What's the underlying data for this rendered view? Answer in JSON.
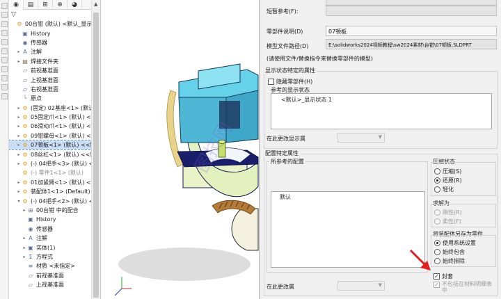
{
  "tree": {
    "tabs": [
      "◉",
      "▤",
      "⊞",
      "⊕",
      "◕"
    ],
    "filter_icon": "filter-icon",
    "items": [
      {
        "label": "00台钳 (默认) <默认_显示状",
        "arrow": "",
        "icon": "assembly-icon",
        "glyph": "⚙",
        "indent": 0,
        "cls": "ic-part",
        "state": ""
      },
      {
        "label": "History",
        "arrow": "",
        "icon": "history-icon",
        "glyph": "▣",
        "indent": 1,
        "cls": "ic-doc",
        "state": ""
      },
      {
        "label": "传感器",
        "arrow": "",
        "icon": "sensor-icon",
        "glyph": "◉",
        "indent": 1,
        "cls": "ic-doc",
        "state": ""
      },
      {
        "label": "注解",
        "arrow": "▸",
        "icon": "annotation-icon",
        "glyph": "A",
        "indent": 1,
        "cls": "ic-doc",
        "state": ""
      },
      {
        "label": "焊接文件夹",
        "arrow": "▸",
        "icon": "weld-folder-icon",
        "glyph": "▤",
        "indent": 1,
        "cls": "ic-folder",
        "state": ""
      },
      {
        "label": "前视基准面",
        "arrow": "",
        "icon": "plane-icon",
        "glyph": "▱",
        "indent": 1,
        "cls": "ic-plane",
        "state": ""
      },
      {
        "label": "上视基准面",
        "arrow": "",
        "icon": "plane-icon",
        "glyph": "▱",
        "indent": 1,
        "cls": "ic-plane",
        "state": ""
      },
      {
        "label": "右视基准面",
        "arrow": "",
        "icon": "plane-icon",
        "glyph": "▱",
        "indent": 1,
        "cls": "ic-plane",
        "state": ""
      },
      {
        "label": "原点",
        "arrow": "",
        "icon": "origin-icon",
        "glyph": "└",
        "indent": 1,
        "cls": "ic-plane",
        "state": ""
      },
      {
        "label": "(固定) 02基座<1> (默认)",
        "arrow": "▸",
        "icon": "part-icon",
        "glyph": "⚙",
        "indent": 1,
        "cls": "ic-part",
        "state": ""
      },
      {
        "label": "05固定爪<1> (默认) <<",
        "arrow": "▸",
        "icon": "part-icon",
        "glyph": "⚙",
        "indent": 1,
        "cls": "ic-part",
        "state": ""
      },
      {
        "label": "06滑动爪<1> (默认) <<",
        "arrow": "▸",
        "icon": "part-icon",
        "glyph": "⚙",
        "indent": 1,
        "cls": "ic-part",
        "state": ""
      },
      {
        "label": "09钳螺母<1> (默认) <<",
        "arrow": "▸",
        "icon": "part-icon",
        "glyph": "⚙",
        "indent": 1,
        "cls": "ic-part",
        "state": ""
      },
      {
        "label": "07顿板<1> (默认) <<默",
        "arrow": "▸",
        "icon": "part-icon",
        "glyph": "⚙",
        "indent": 1,
        "cls": "ic-part",
        "state": "sel"
      },
      {
        "label": "08丝杠<1> (默认) <<默",
        "arrow": "▸",
        "icon": "part-icon",
        "glyph": "⚙",
        "indent": 1,
        "cls": "ic-part",
        "state": ""
      },
      {
        "label": "(-) 04把手<3> (默认) <<",
        "arrow": "▸",
        "icon": "part-icon",
        "glyph": "⚙",
        "indent": 1,
        "cls": "ic-part",
        "state": ""
      },
      {
        "label": "(-) 零件1<1> (默认)",
        "arrow": "",
        "icon": "part-icon",
        "glyph": "⚙",
        "indent": 1,
        "cls": "ic-part",
        "state": "grey"
      },
      {
        "label": "01加紧臂<1> (默认) <<",
        "arrow": "▸",
        "icon": "part-icon",
        "glyph": "⚙",
        "indent": 1,
        "cls": "ic-part",
        "state": ""
      },
      {
        "label": "装配体1<1> (Default)",
        "arrow": "▸",
        "icon": "subassembly-icon",
        "glyph": "⚙",
        "indent": 1,
        "cls": "ic-part",
        "state": ""
      },
      {
        "label": "(-) 04把手<2> (默认) <<",
        "arrow": "▾",
        "icon": "part-icon",
        "glyph": "⚙",
        "indent": 1,
        "cls": "ic-part",
        "state": ""
      },
      {
        "label": "00台钳 中的配合",
        "arrow": "▸",
        "icon": "mates-icon",
        "glyph": "⊞",
        "indent": 2,
        "cls": "ic-doc",
        "state": ""
      },
      {
        "label": "History",
        "arrow": "",
        "icon": "history-icon",
        "glyph": "▣",
        "indent": 2,
        "cls": "ic-doc",
        "state": ""
      },
      {
        "label": "传感器",
        "arrow": "",
        "icon": "sensor-icon",
        "glyph": "◉",
        "indent": 2,
        "cls": "ic-doc",
        "state": ""
      },
      {
        "label": "注解",
        "arrow": "▸",
        "icon": "annotation-icon",
        "glyph": "A",
        "indent": 2,
        "cls": "ic-doc",
        "state": ""
      },
      {
        "label": "实体(1)",
        "arrow": "▸",
        "icon": "solid-bodies-icon",
        "glyph": "▣",
        "indent": 2,
        "cls": "ic-doc",
        "state": ""
      },
      {
        "label": "方程式",
        "arrow": "▸",
        "icon": "equations-icon",
        "glyph": "Σ",
        "indent": 2,
        "cls": "ic-doc",
        "state": ""
      },
      {
        "label": "材质 <未指定>",
        "arrow": "",
        "icon": "material-icon",
        "glyph": "≡",
        "indent": 2,
        "cls": "ic-doc",
        "state": ""
      },
      {
        "label": "前视基准面",
        "arrow": "",
        "icon": "plane-icon",
        "glyph": "▱",
        "indent": 2,
        "cls": "ic-plane",
        "state": ""
      },
      {
        "label": "上视基准面",
        "arrow": "",
        "icon": "plane-icon",
        "glyph": "▱",
        "indent": 2,
        "cls": "ic-plane",
        "state": ""
      }
    ]
  },
  "props": {
    "short_ref_label": "短暂参考(F):",
    "part_desc_label": "零部件说明(D)",
    "part_desc_value": "07顿板",
    "model_path_label": "模型文件路径(D)",
    "model_path_value": "E:\\solidworks2024视频教程\\sw2024素材\\台钳\\07顿板.SLDPRT",
    "replace_hint": "(请使用文件/替换指令来替换零部件的模型)",
    "display_group_title": "显示状态特定的属性",
    "hide_part_label": "隐藏零部件(H)",
    "ref_display_label": "参考的显示状态",
    "display_state_item": "<默认>_显示状态 1",
    "change_display_label": "在此更改显示属",
    "config_group_title": "配置特定属性",
    "ref_config_label": "所参考的配置",
    "config_item": "默认",
    "compress_title": "压缩状态",
    "compress_opt1": "压缩(S)",
    "compress_opt2": "还原(R)",
    "compress_opt3": "轻化",
    "solve_title": "求解为",
    "solve_opt1": "刚性(R)",
    "solve_opt2": "柔性(F)",
    "save_as_title": "将装配体另存为零件",
    "save_opt1": "使用系统设置",
    "save_opt2": "始终包含",
    "save_opt3": "始终排除",
    "envelope_label": "封套",
    "exclude_bom_label": "不包括在材料明细表中",
    "change_config_label": "在此更改属"
  },
  "viewport": {
    "watermark": "图技网",
    "colors": {
      "cyan": "#55c8e0",
      "navy": "#1a1f6b",
      "green": "#e6f2c2",
      "brown": "#a06a30"
    }
  }
}
